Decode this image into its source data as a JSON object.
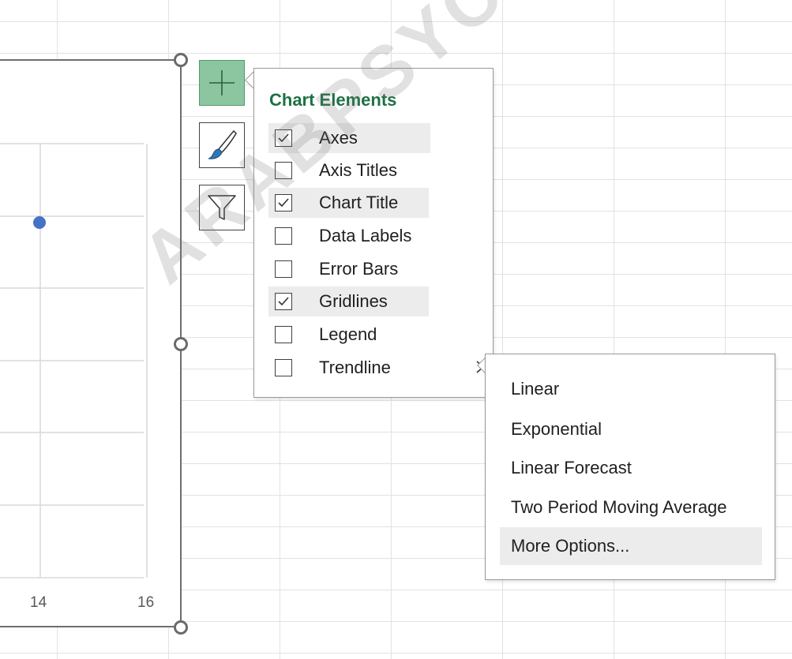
{
  "chart": {
    "x_tick_labels": [
      "14",
      "16"
    ],
    "marker_color": "#4472c4"
  },
  "chart_tools": {
    "elements_button": "plus-icon",
    "styles_button": "paintbrush-icon",
    "filters_button": "funnel-icon",
    "accent_color": "#8bc6a0"
  },
  "chart_elements": {
    "title": "Chart Elements",
    "title_color": "#1e7145",
    "items": [
      {
        "label": "Axes",
        "checked": true
      },
      {
        "label": "Axis Titles",
        "checked": false
      },
      {
        "label": "Chart Title",
        "checked": true
      },
      {
        "label": "Data Labels",
        "checked": false
      },
      {
        "label": "Error Bars",
        "checked": false
      },
      {
        "label": "Gridlines",
        "checked": true
      },
      {
        "label": "Legend",
        "checked": false
      },
      {
        "label": "Trendline",
        "checked": false
      }
    ]
  },
  "trendline_menu": {
    "items": [
      {
        "label": "Linear"
      },
      {
        "label": "Exponential"
      },
      {
        "label": "Linear Forecast"
      },
      {
        "label": "Two Period Moving Average"
      },
      {
        "label": "More Options..."
      }
    ]
  },
  "watermark": {
    "text": "ARABPSYCHOLOGY"
  }
}
